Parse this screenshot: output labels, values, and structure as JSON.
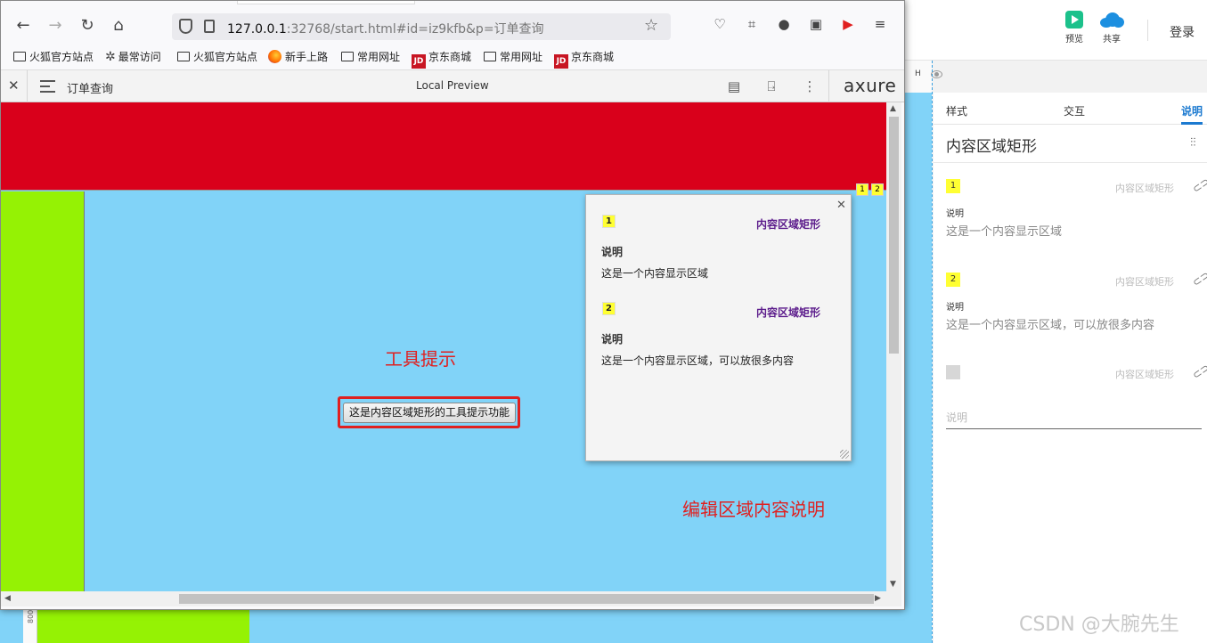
{
  "browser": {
    "url_host": "127.0.0.1",
    "url_rest": ":32768/start.html#id=iz9kfb&p=订单查询",
    "bookmarks": [
      {
        "label": "火狐官方站点",
        "icon": "folder-icon"
      },
      {
        "label": "最常访问",
        "icon": "gear-icon"
      },
      {
        "label": "火狐官方站点",
        "icon": "folder-icon"
      },
      {
        "label": "新手上路",
        "icon": "firefox-icon"
      },
      {
        "label": "常用网址",
        "icon": "folder-icon"
      },
      {
        "label": "京东商城",
        "icon": "jd-icon"
      },
      {
        "label": "常用网址",
        "icon": "folder-icon"
      },
      {
        "label": "京东商城",
        "icon": "jd-icon"
      }
    ],
    "jd_badge": "JD"
  },
  "axure_bar": {
    "page_name": "订单查询",
    "preview_label": "Local Preview",
    "logo": "axure"
  },
  "prototype": {
    "markers": [
      "1",
      "2"
    ],
    "tooltip_label": "工具提示",
    "tooltip_button": "这是内容区域矩形的工具提示功能",
    "edit_label": "编辑区域内容说明",
    "notes_popup": {
      "notes": [
        {
          "num": "1",
          "widget": "内容区域矩形",
          "field": "说明",
          "value": "这是一个内容显示区域"
        },
        {
          "num": "2",
          "widget": "内容区域矩形",
          "field": "说明",
          "value": "这是一个内容显示区域，可以放很多内容"
        }
      ]
    }
  },
  "editor": {
    "preview_label": "预览",
    "share_label": "共享",
    "login_label": "登录",
    "h_label": "H",
    "ruler_value": "800",
    "tabs": [
      "样式",
      "交互",
      "说明"
    ],
    "panel_title": "内容区域矩形",
    "notes": [
      {
        "num": "1",
        "widget": "内容区域矩形",
        "field": "说明",
        "value": "这是一个内容显示区域"
      },
      {
        "num": "2",
        "widget": "内容区域矩形",
        "field": "说明",
        "value": "这是一个内容显示区域，可以放很多内容"
      }
    ],
    "new_note": {
      "widget": "内容区域矩形",
      "placeholder": "说明"
    }
  },
  "watermark": "CSDN @大腕先生",
  "colors": {
    "header_red": "#d9001b",
    "sidebar_green": "#95f204",
    "content_blue": "#81d3f8",
    "note_yellow": "#ffff33",
    "annotation_red": "#e02020",
    "accent_blue": "#1c7ad0"
  }
}
